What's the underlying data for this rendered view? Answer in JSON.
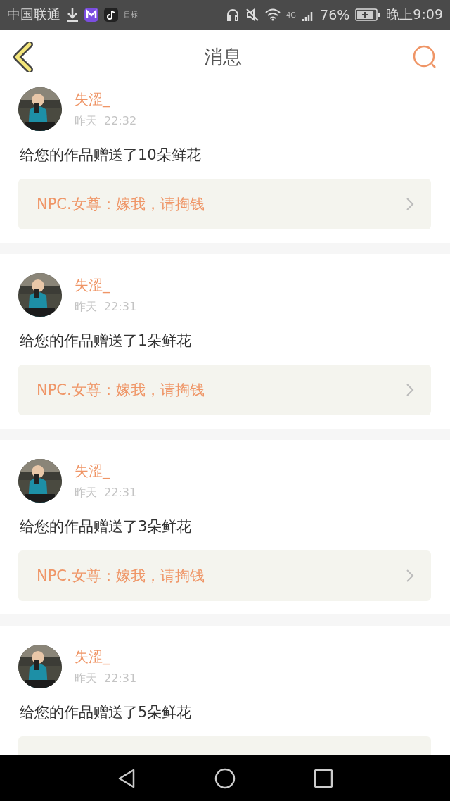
{
  "status_bar": {
    "carrier": "中国联通",
    "app_label": "目标",
    "network": "4G",
    "battery": "76%",
    "time": "晚上9:09"
  },
  "header": {
    "title": "消息"
  },
  "messages": [
    {
      "name": "失涩_",
      "date": "昨天",
      "time": "22:32",
      "text": "给您的作品赠送了10朵鲜花",
      "quote": "NPC.女尊：嫁我，请掏钱"
    },
    {
      "name": "失涩_",
      "date": "昨天",
      "time": "22:31",
      "text": "给您的作品赠送了1朵鲜花",
      "quote": "NPC.女尊：嫁我，请掏钱"
    },
    {
      "name": "失涩_",
      "date": "昨天",
      "time": "22:31",
      "text": "给您的作品赠送了3朵鲜花",
      "quote": "NPC.女尊：嫁我，请掏钱"
    },
    {
      "name": "失涩_",
      "date": "昨天",
      "time": "22:31",
      "text": "给您的作品赠送了5朵鲜花"
    }
  ]
}
